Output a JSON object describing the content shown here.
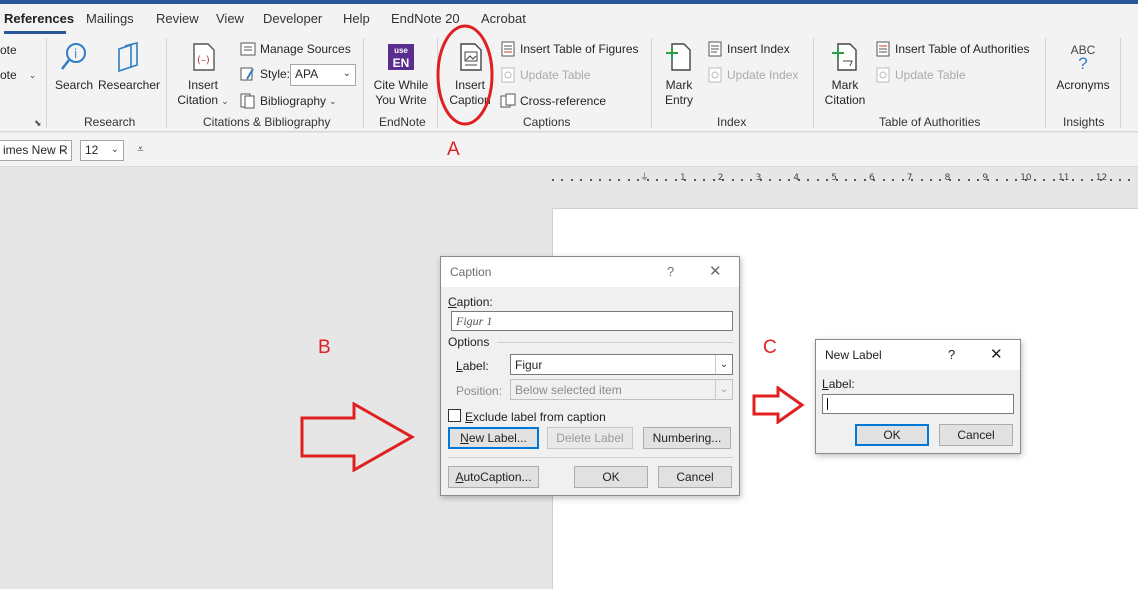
{
  "tabs": [
    {
      "label": "References",
      "active": true
    },
    {
      "label": "Mailings"
    },
    {
      "label": "Review"
    },
    {
      "label": "View"
    },
    {
      "label": "Developer"
    },
    {
      "label": "Help"
    },
    {
      "label": "EndNote 20"
    },
    {
      "label": "Acrobat"
    }
  ],
  "ribbon": {
    "partial_top": "ote",
    "partial_bottom": "ote",
    "research": {
      "search": "Search",
      "researcher": "Researcher",
      "group_label": "Research"
    },
    "citations": {
      "insert_citation_line1": "Insert",
      "insert_citation_line2": "Citation",
      "manage_sources": "Manage Sources",
      "style_label": "Style:",
      "style_value": "APA",
      "bibliography": "Bibliography",
      "group_label": "Citations & Bibliography"
    },
    "endnote": {
      "icon_top": "use",
      "icon_main": "EN",
      "cite_line1": "Cite While",
      "cite_line2": "You Write",
      "group_label": "EndNote"
    },
    "captions": {
      "insert_caption_line1": "Insert",
      "insert_caption_line2": "Caption",
      "insert_table_of_figures": "Insert Table of Figures",
      "update_table": "Update Table",
      "cross_reference": "Cross-reference",
      "group_label": "Captions"
    },
    "index": {
      "mark_entry_line1": "Mark",
      "mark_entry_line2": "Entry",
      "insert_index": "Insert Index",
      "update_index": "Update Index",
      "group_label": "Index"
    },
    "authorities": {
      "mark_citation_line1": "Mark",
      "mark_citation_line2": "Citation",
      "insert_table_of_authorities": "Insert Table of Authorities",
      "update_table": "Update Table",
      "group_label": "Table of Authorities"
    },
    "insights": {
      "abc": "ABC",
      "q": "?",
      "acronyms": "Acronyms",
      "group_label": "Insights"
    }
  },
  "fontbar": {
    "font_name": "imes New R",
    "font_size": "12"
  },
  "ruler": {
    "numbers": [
      "1",
      "2",
      "3",
      "4",
      "5",
      "6",
      "7",
      "8",
      "9",
      "10",
      "11",
      "12"
    ]
  },
  "annotations": {
    "a": "A",
    "b": "B",
    "c": "C",
    "color": "#e02020"
  },
  "caption_dialog": {
    "title": "Caption",
    "help": "?",
    "close": "✕",
    "caption_label_u": "C",
    "caption_label_rest": "aption:",
    "caption_value": "Figur 1",
    "options_label": "Options",
    "label_label_u": "L",
    "label_label_rest": "abel:",
    "label_value": "Figur",
    "position_label": "Position:",
    "position_value": "Below selected item",
    "exclude_u": "E",
    "exclude_rest": "xclude label from caption",
    "new_label_button_u": "N",
    "new_label_button_rest": "ew Label...",
    "delete_label_button": "Delete Label",
    "numbering_button_u": "U",
    "numbering_button_rest": "Numbering...",
    "autocaption_button_u": "A",
    "autocaption_button_rest": "utoCaption...",
    "ok_button": "OK",
    "cancel_button": "Cancel"
  },
  "new_label_dialog": {
    "title": "New Label",
    "help": "?",
    "close": "✕",
    "label_label_u": "L",
    "label_label_rest": "abel:",
    "label_value": "",
    "ok_button": "OK",
    "cancel_button": "Cancel"
  }
}
